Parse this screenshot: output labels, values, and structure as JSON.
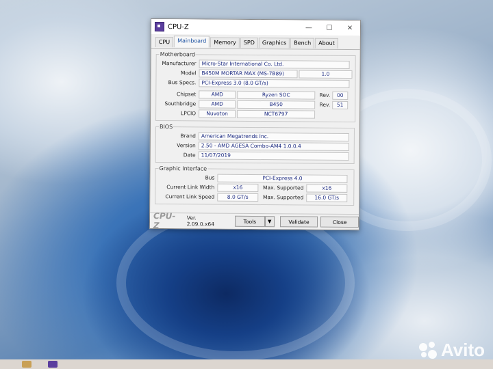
{
  "window": {
    "title": "CPU-Z"
  },
  "tabs": [
    "CPU",
    "Mainboard",
    "Memory",
    "SPD",
    "Graphics",
    "Bench",
    "About"
  ],
  "active_tab": "Mainboard",
  "motherboard": {
    "legend": "Motherboard",
    "manufacturer_label": "Manufacturer",
    "manufacturer": "Micro-Star International Co. Ltd.",
    "model_label": "Model",
    "model": "B450M MORTAR MAX (MS-7B89)",
    "model_rev": "1.0",
    "bus_specs_label": "Bus Specs.",
    "bus_specs": "PCI-Express 3.0 (8.0 GT/s)",
    "chipset_label": "Chipset",
    "chipset_vendor": "AMD",
    "chipset_name": "Ryzen SOC",
    "chipset_rev_label": "Rev.",
    "chipset_rev": "00",
    "southbridge_label": "Southbridge",
    "southbridge_vendor": "AMD",
    "southbridge_name": "B450",
    "southbridge_rev_label": "Rev.",
    "southbridge_rev": "51",
    "lpcio_label": "LPCIO",
    "lpcio_vendor": "Nuvoton",
    "lpcio_name": "NCT6797"
  },
  "bios": {
    "legend": "BIOS",
    "brand_label": "Brand",
    "brand": "American Megatrends Inc.",
    "version_label": "Version",
    "version": "2.50 - AMD AGESA Combo-AM4 1.0.0.4",
    "date_label": "Date",
    "date": "11/07/2019"
  },
  "graphic_interface": {
    "legend": "Graphic Interface",
    "bus_label": "Bus",
    "bus": "PCI-Express 4.0",
    "link_width_label": "Current Link Width",
    "link_width": "x16",
    "max_width_label": "Max. Supported",
    "max_width": "x16",
    "link_speed_label": "Current Link Speed",
    "link_speed": "8.0 GT/s",
    "max_speed_label": "Max. Supported",
    "max_speed": "16.0 GT/s"
  },
  "footer": {
    "logo": "CPU-Z",
    "version": "Ver. 2.09.0.x64",
    "tools": "Tools",
    "validate": "Validate",
    "close": "Close"
  },
  "watermark": "Avito",
  "colors": {
    "value_text": "#1c2b82",
    "active_tab": "#1a4fa0",
    "taskbar": "#dcd6d0"
  }
}
